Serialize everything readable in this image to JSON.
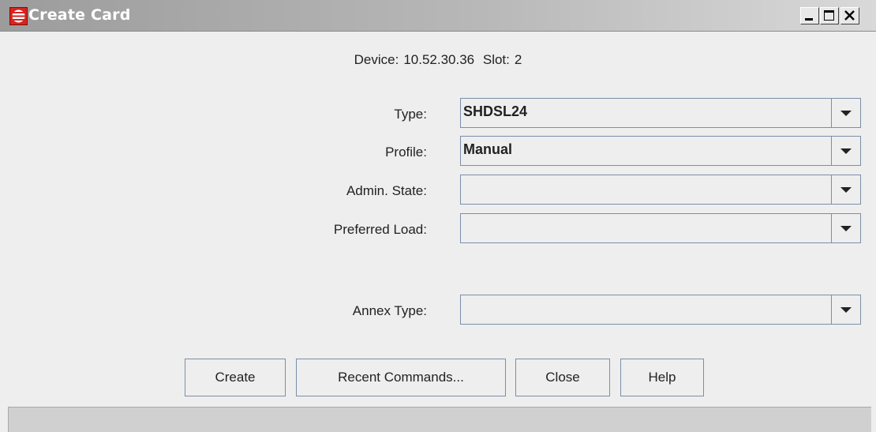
{
  "window": {
    "title": "Create Card",
    "icon": "app-logo-icon",
    "controls": [
      "minimize-icon",
      "maximize-icon",
      "close-icon"
    ]
  },
  "info": {
    "device_label": "Device:",
    "device_value": "10.52.30.36",
    "slot_label": "Slot:",
    "slot_value": "2"
  },
  "form": {
    "type": {
      "label": "Type:",
      "value": "SHDSL24"
    },
    "profile": {
      "label": "Profile:",
      "value": "Manual"
    },
    "admin_state": {
      "label": "Admin. State:",
      "value": ""
    },
    "preferred_load": {
      "label": "Preferred Load:",
      "value": ""
    },
    "annex_type": {
      "label": "Annex Type:",
      "value": ""
    }
  },
  "buttons": {
    "create": "Create",
    "recent_commands": "Recent Commands...",
    "close": "Close",
    "help": "Help"
  },
  "status_bar": {
    "text": ""
  },
  "colors": {
    "title_bar": "#b0b0b0",
    "window_bg": "#eeeeee",
    "field_border": "#7a8fa8",
    "icon_red": "#d8231f"
  }
}
